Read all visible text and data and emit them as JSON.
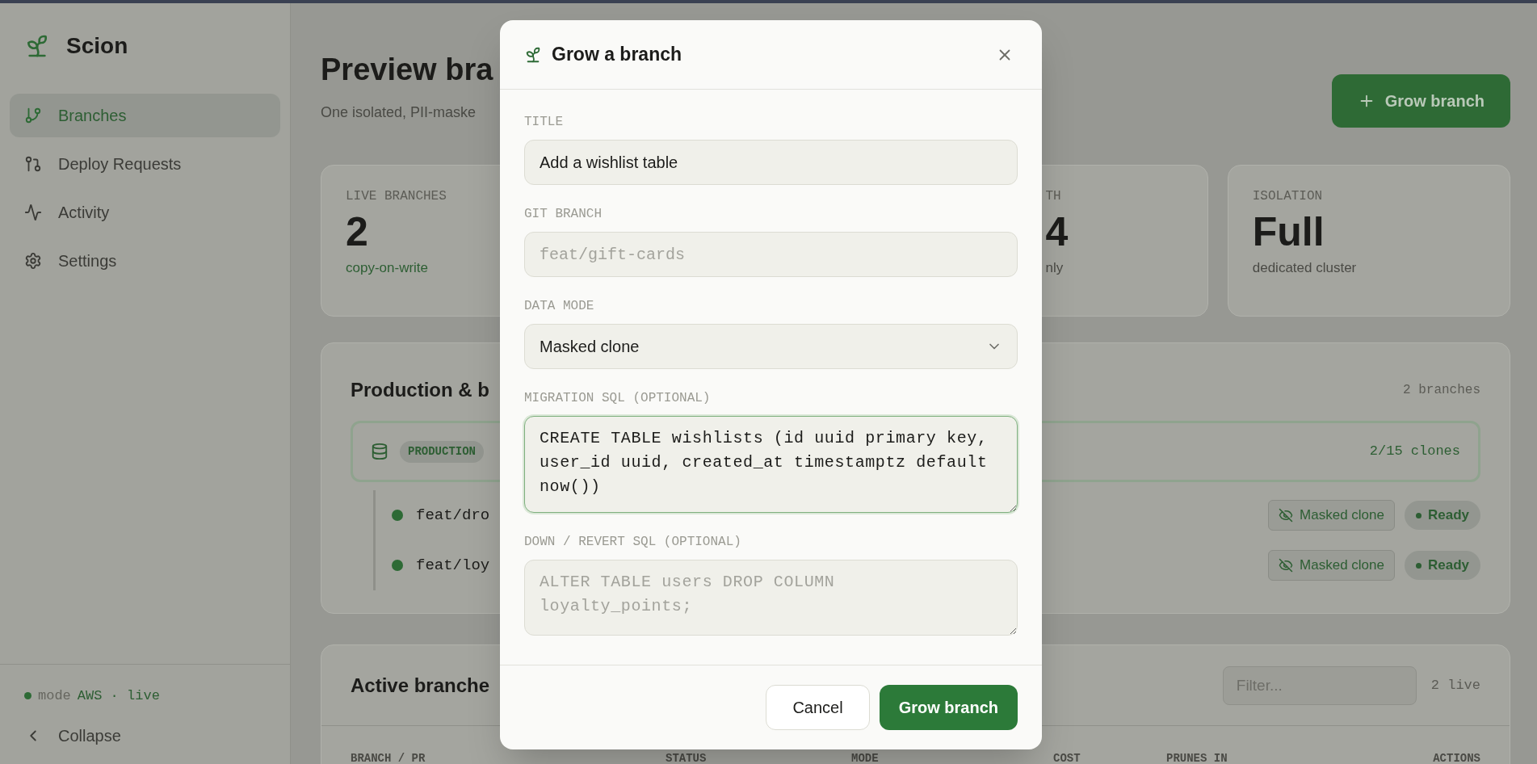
{
  "sidebar": {
    "brand": "Scion",
    "items": [
      {
        "label": "Branches",
        "selected": true
      },
      {
        "label": "Deploy Requests",
        "selected": false
      },
      {
        "label": "Activity",
        "selected": false
      },
      {
        "label": "Settings",
        "selected": false
      }
    ],
    "footer": {
      "mode_label": "mode",
      "mode_value": "AWS · live",
      "collapse": "Collapse"
    }
  },
  "header": {
    "title": "Preview bra",
    "subtitle": "One isolated, PII-maske",
    "action": "Grow branch"
  },
  "stats": [
    {
      "label": "LIVE BRANCHES",
      "value": "2",
      "note": "copy-on-write",
      "accent_note": true,
      "covered_left": false
    },
    {
      "label": "TH",
      "value": "4",
      "note": "nly",
      "accent_note": false,
      "covered_left": true
    },
    {
      "label": "ISOLATION",
      "value": "Full",
      "note": "dedicated cluster",
      "accent_note": false,
      "covered_left": false
    }
  ],
  "production": {
    "title": "Production & b",
    "count": "2 branches",
    "badge": "PRODUCTION",
    "clones": "2/15 clones",
    "branches": [
      {
        "name": "feat/dro",
        "mode": "Masked clone",
        "status": "Ready"
      },
      {
        "name": "feat/loy",
        "mode": "Masked clone",
        "status": "Ready"
      }
    ]
  },
  "active": {
    "title": "Active branche",
    "filter_placeholder": "Filter...",
    "count": "2 live",
    "columns": [
      "BRANCH / PR",
      "STATUS",
      "MODE",
      "COST",
      "PRUNES IN",
      "ACTIONS"
    ]
  },
  "dialog": {
    "title": "Grow a branch",
    "fields": [
      {
        "kind": "text",
        "label": "TITLE",
        "value": "Add a wishlist table",
        "mono": false
      },
      {
        "kind": "text",
        "label": "GIT BRANCH",
        "placeholder": "feat/gift-cards",
        "mono": true
      },
      {
        "kind": "select",
        "label": "DATA MODE",
        "value": "Masked clone"
      },
      {
        "kind": "textarea",
        "label": "MIGRATION SQL (OPTIONAL)",
        "value": "CREATE TABLE wishlists (id uuid primary key, user_id uuid, created_at timestamptz default now())",
        "focused": true
      },
      {
        "kind": "textarea",
        "label": "DOWN / REVERT SQL (OPTIONAL)",
        "placeholder": "ALTER TABLE users DROP COLUMN loyalty_points;",
        "focused": false
      }
    ],
    "cancel": "Cancel",
    "submit": "Grow branch"
  }
}
